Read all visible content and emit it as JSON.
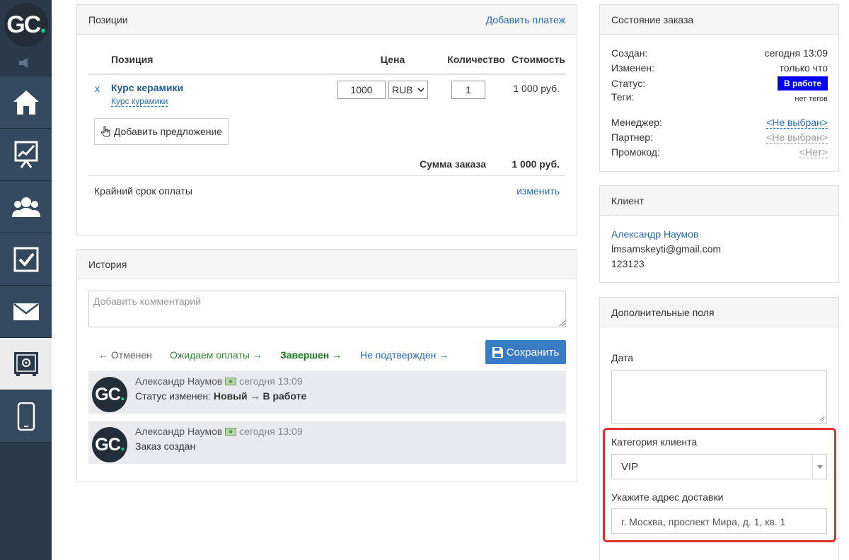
{
  "logo": {
    "text": "GC",
    "dot": "."
  },
  "sidebar": {
    "items": [
      {
        "icon": "speaker-icon"
      },
      {
        "icon": "home-icon"
      },
      {
        "icon": "chart-board-icon"
      },
      {
        "icon": "users-icon"
      },
      {
        "icon": "checkbox-icon"
      },
      {
        "icon": "envelope-icon"
      },
      {
        "icon": "safe-icon",
        "active": true
      },
      {
        "icon": "phone-icon"
      }
    ]
  },
  "positions": {
    "title": "Позиции",
    "add_payment": "Добавить платеж",
    "headers": {
      "position": "Позиция",
      "price": "Цена",
      "quantity": "Количество",
      "cost": "Стоимость"
    },
    "row": {
      "remove": "x",
      "name": "Курс керамики",
      "subname": "Курс курамики",
      "price": "1000",
      "currency": "RUB",
      "quantity": "1",
      "cost": "1 000 руб."
    },
    "add_offer": "Добавить предложение",
    "total_label": "Сумма заказа",
    "total_value": "1 000 руб.",
    "deadline_label": "Крайний срок оплаты",
    "deadline_action": "изменить"
  },
  "history": {
    "title": "История",
    "comment_placeholder": "Добавить комментарий",
    "statuses": [
      "← Отменен",
      "Ожидаем оплаты →",
      "Завершен →",
      "Не подтвержден →"
    ],
    "save": "Сохранить",
    "entries": [
      {
        "author": "Александр Наумов",
        "time": "сегодня 13:09",
        "prefix": "Статус изменен:",
        "text": "Новый → В работе"
      },
      {
        "author": "Александр Наумов",
        "time": "сегодня 13:09",
        "prefix": "",
        "text": "Заказ создан"
      }
    ]
  },
  "order_state": {
    "title": "Состояние заказа",
    "created_label": "Создан:",
    "created": "сегодня 13:09",
    "changed_label": "Изменен:",
    "changed": "только что",
    "status_label": "Статус:",
    "status": "В работе",
    "tags_label": "Теги:",
    "tags": "нет тегов",
    "manager_label": "Менеджер:",
    "manager": "<Не выбран>",
    "partner_label": "Партнер:",
    "partner": "<Не выбран>",
    "promo_label": "Промокод:",
    "promo": "<Нет>"
  },
  "client": {
    "title": "Клиент",
    "name": "Александр Наумов",
    "email": "lmsamskeyti@gmail.com",
    "phone": "123123"
  },
  "extra": {
    "title": "Дополнительные поля",
    "date_label": "Дата",
    "category_label": "Категория клиента",
    "category_value": "VIP",
    "address_label": "Укажите адрес доставки",
    "address_value": "г. Москва, проспект Мира, д. 1, кв. 1"
  },
  "colors": {
    "accent": "#2a6bb5",
    "status_badge": "#0000ff",
    "highlight": "#e03030",
    "green": "#2e8b2e"
  }
}
